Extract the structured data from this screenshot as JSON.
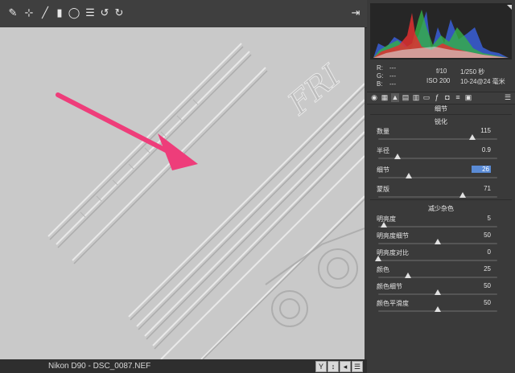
{
  "toolbar": {
    "tools": [
      "adjustment-brush-icon",
      "spot-removal-icon",
      "brush-icon",
      "graduated-filter-icon",
      "radial-filter-icon",
      "list-icon",
      "rotate-ccw-icon",
      "rotate-cw-icon"
    ],
    "export_icon": "export-icon"
  },
  "status": {
    "filename": "Nikon D90 - DSC_0087.NEF",
    "buttons": [
      "Y",
      "↕",
      "◂",
      "☰"
    ]
  },
  "info": {
    "r": "R:",
    "g": "G:",
    "b": "B:",
    "dash": "---",
    "aperture": "f/10",
    "shutter": "1/250 秒",
    "iso": "ISO 200",
    "lens": "10-24@24 毫米"
  },
  "panel": {
    "title": "细节",
    "sharpen_title": "锐化",
    "noise_title": "减少杂色",
    "sharpen": [
      {
        "label": "数量",
        "value": "115",
        "pos": 0.79,
        "highlight": false
      },
      {
        "label": "半径",
        "value": "0.9",
        "pos": 0.16,
        "highlight": false
      },
      {
        "label": "细节",
        "value": "26",
        "pos": 0.26,
        "highlight": true
      },
      {
        "label": "蒙版",
        "value": "71",
        "pos": 0.71,
        "highlight": false
      }
    ],
    "noise": [
      {
        "label": "明亮度",
        "value": "5",
        "pos": 0.05
      },
      {
        "label": "明亮度细节",
        "value": "50",
        "pos": 0.5
      },
      {
        "label": "明亮度对比",
        "value": "0",
        "pos": 0.0
      },
      {
        "label": "颜色",
        "value": "25",
        "pos": 0.25
      },
      {
        "label": "颜色细节",
        "value": "50",
        "pos": 0.5
      },
      {
        "label": "颜色平滑度",
        "value": "50",
        "pos": 0.5
      }
    ]
  },
  "colors": {
    "arrow": "#ee3d7a",
    "highlight": "#5a8bd6"
  }
}
